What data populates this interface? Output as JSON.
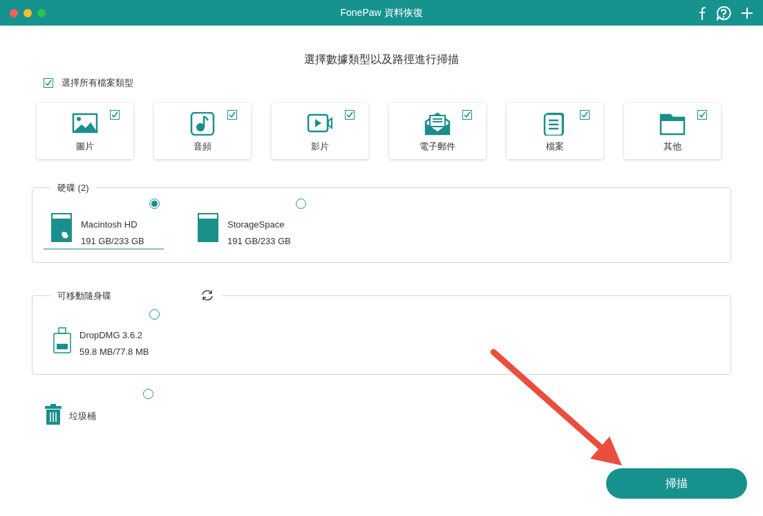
{
  "window": {
    "title": "FonePaw 資料恢復"
  },
  "heading": "選擇數據類型以及路徑進行掃描",
  "select_all": {
    "label": "選擇所有檔案類型",
    "checked": true
  },
  "file_types": [
    {
      "kind": "image",
      "label": "圖片",
      "checked": true
    },
    {
      "kind": "audio",
      "label": "音頻",
      "checked": true
    },
    {
      "kind": "video",
      "label": "影片",
      "checked": true
    },
    {
      "kind": "email",
      "label": "電子郵件",
      "checked": true
    },
    {
      "kind": "document",
      "label": "檔案",
      "checked": true
    },
    {
      "kind": "other",
      "label": "其他",
      "checked": true
    }
  ],
  "sections": [
    {
      "kind": "disks",
      "title": "硬碟 (2)",
      "drives": [
        {
          "kind": "mac",
          "name": "Macintosh HD",
          "size": "191 GB/233 GB",
          "selected": true
        },
        {
          "kind": "disk",
          "name": "StorageSpace",
          "size": "191 GB/233 GB",
          "selected": false
        }
      ]
    },
    {
      "kind": "removable",
      "title": "可移動隨身碟",
      "drives": [
        {
          "kind": "usb",
          "name": "DropDMG 3.6.2",
          "size": "59.8 MB/77.8 MB",
          "selected": false
        }
      ]
    }
  ],
  "trash": {
    "label": "垃圾桶",
    "selected": false
  },
  "scan_button": "掃描"
}
